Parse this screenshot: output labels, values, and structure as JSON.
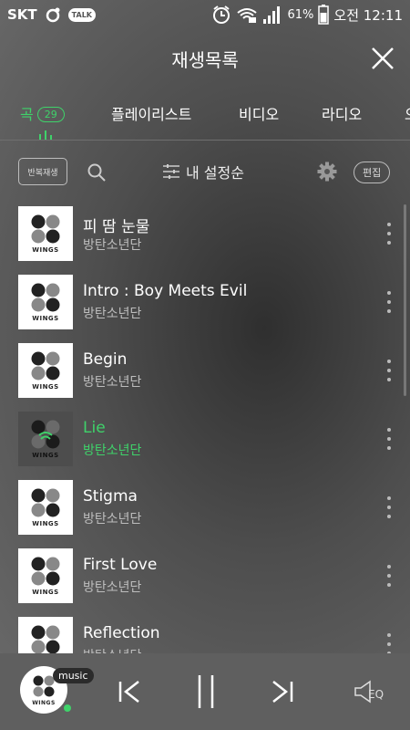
{
  "status_bar": {
    "carrier": "SKT",
    "talk_label": "TALK",
    "battery": "61%",
    "time": "오전 12:11"
  },
  "header": {
    "title": "재생목록"
  },
  "tabs": [
    {
      "label": "곡",
      "badge": "29",
      "active": true
    },
    {
      "label": "플레이리스트",
      "active": false
    },
    {
      "label": "비디오",
      "active": false
    },
    {
      "label": "라디오",
      "active": false
    },
    {
      "label": "오",
      "active": false
    }
  ],
  "toolbar": {
    "repeat_label": "반복재생",
    "sort_label": "내 설정순",
    "edit_label": "편집"
  },
  "album_cover_text": "WINGS",
  "tracks": [
    {
      "title": "피 땀 눈물",
      "artist": "방탄소년단",
      "playing": false
    },
    {
      "title": "Intro : Boy Meets Evil",
      "artist": "방탄소년단",
      "playing": false
    },
    {
      "title": "Begin",
      "artist": "방탄소년단",
      "playing": false
    },
    {
      "title": "Lie",
      "artist": "방탄소년단",
      "playing": true
    },
    {
      "title": "Stigma",
      "artist": "방탄소년단",
      "playing": false
    },
    {
      "title": "First Love",
      "artist": "방탄소년단",
      "playing": false
    },
    {
      "title": "Reflection",
      "artist": "방탄소년단",
      "playing": false
    }
  ],
  "player": {
    "music_tag": "music",
    "eq_label": "EQ"
  },
  "colors": {
    "accent": "#3fd26a",
    "player_bg": "#5f5f5f"
  }
}
